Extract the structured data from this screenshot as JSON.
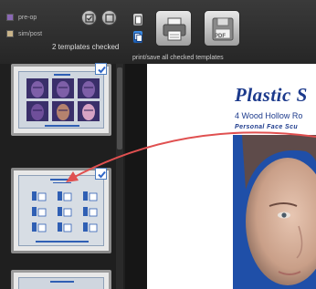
{
  "legend": {
    "pre_op": "pre-op",
    "sim_post": "sim/post"
  },
  "toolbar": {
    "count_text": "2 templates checked",
    "print_caption": "print/save all checked templates",
    "pdf_label": "PDF"
  },
  "document": {
    "title": "Plastic S",
    "address": "4 Wood Hollow Ro",
    "tagline": "Personal Face Scu"
  },
  "colors": {
    "pre_op_swatch": "#8a68b5",
    "sim_post_swatch": "#c9b48a",
    "accent_blue": "#1c3a8c",
    "arrow_red": "#e05050"
  },
  "templates": [
    {
      "name": "face-grid-template",
      "checked": true
    },
    {
      "name": "icon-grid-template",
      "checked": true
    },
    {
      "name": "third-template",
      "checked": false
    }
  ]
}
